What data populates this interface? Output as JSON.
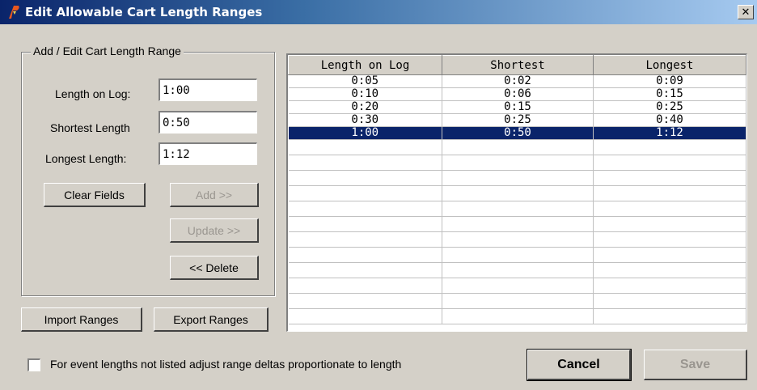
{
  "window": {
    "title": "Edit Allowable Cart Length Ranges",
    "close_glyph": "✕"
  },
  "group": {
    "title": "Add / Edit Cart Length Range",
    "length_on_log_label": "Length on Log:",
    "length_on_log_value": "1:00",
    "shortest_label": "Shortest Length",
    "shortest_value": "0:50",
    "longest_label": "Longest Length:",
    "longest_value": "1:12",
    "clear_label": "Clear Fields",
    "add_label": "Add >>",
    "update_label": "Update >>",
    "delete_label": "<< Delete"
  },
  "import_label": "Import Ranges",
  "export_label": "Export Ranges",
  "table": {
    "headers": [
      "Length on Log",
      "Shortest",
      "Longest"
    ],
    "rows": [
      [
        "0:05",
        "0:02",
        "0:09"
      ],
      [
        "0:10",
        "0:06",
        "0:15"
      ],
      [
        "0:20",
        "0:15",
        "0:25"
      ],
      [
        "0:30",
        "0:25",
        "0:40"
      ],
      [
        "1:00",
        "0:50",
        "1:12"
      ]
    ],
    "selected_row": 4
  },
  "checkbox_label": "For event lengths not listed adjust range deltas proportionate to length",
  "cancel_label": "Cancel",
  "save_label": "Save",
  "icons": {
    "app": "app-logo-icon",
    "close": "close-icon",
    "checkbox": "checkbox-unchecked"
  },
  "colors": {
    "dialog_bg": "#d4d0c8",
    "title_bar": "#0a246a",
    "selection": "#0a246a",
    "app_icon": "#e8571e"
  }
}
